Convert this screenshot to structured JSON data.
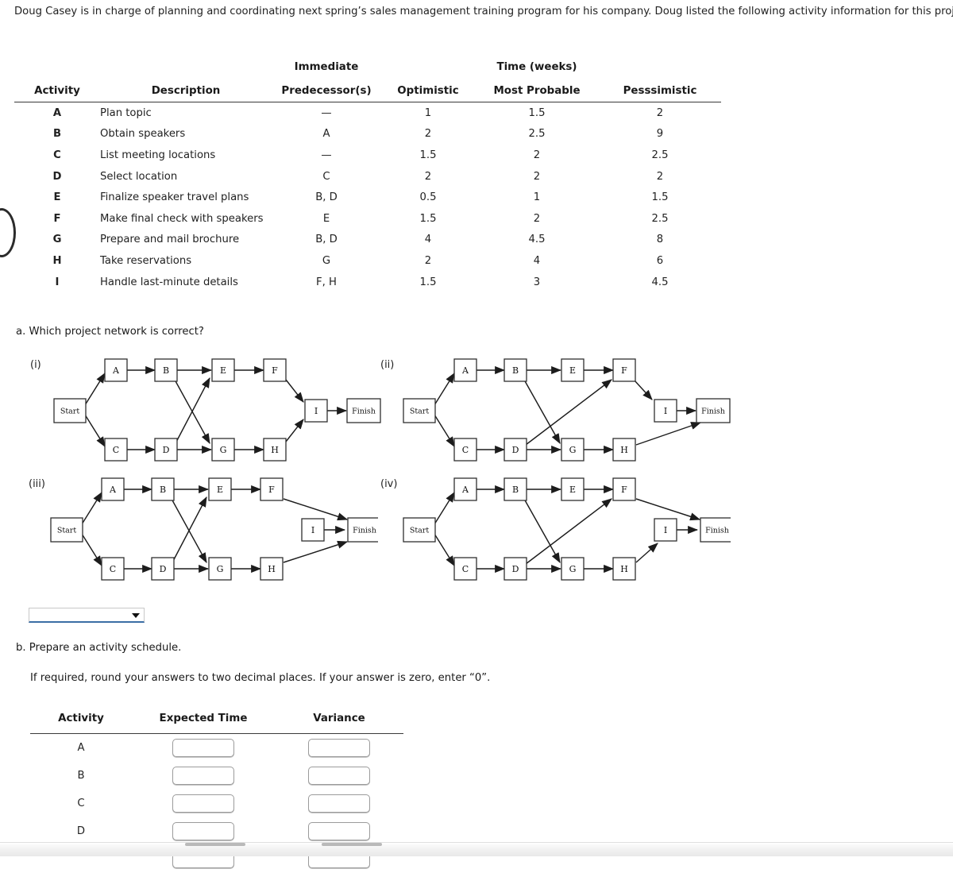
{
  "intro": {
    "text": "Doug Casey is in charge of planning and coordinating next spring’s sales management training program for his company. Doug listed the following activity information for this project:"
  },
  "activity_table": {
    "group_headers": {
      "immediate": "Immediate",
      "time": "Time (weeks)"
    },
    "headers": {
      "activity": "Activity",
      "description": "Description",
      "predecessors": "Predecessor(s)",
      "optimistic": "Optimistic",
      "most_probable": "Most Probable",
      "pessimistic": "Pesssimistic"
    },
    "rows": [
      {
        "activity": "A",
        "description": "Plan topic",
        "predecessors": "—",
        "optimistic": "1",
        "most_probable": "1.5",
        "pessimistic": "2"
      },
      {
        "activity": "B",
        "description": "Obtain speakers",
        "predecessors": "A",
        "optimistic": "2",
        "most_probable": "2.5",
        "pessimistic": "9"
      },
      {
        "activity": "C",
        "description": "List meeting locations",
        "predecessors": "—",
        "optimistic": "1.5",
        "most_probable": "2",
        "pessimistic": "2.5"
      },
      {
        "activity": "D",
        "description": "Select location",
        "predecessors": "C",
        "optimistic": "2",
        "most_probable": "2",
        "pessimistic": "2"
      },
      {
        "activity": "E",
        "description": "Finalize speaker travel plans",
        "predecessors": "B, D",
        "optimistic": "0.5",
        "most_probable": "1",
        "pessimistic": "1.5"
      },
      {
        "activity": "F",
        "description": "Make final check with speakers",
        "predecessors": "E",
        "optimistic": "1.5",
        "most_probable": "2",
        "pessimistic": "2.5"
      },
      {
        "activity": "G",
        "description": "Prepare and mail brochure",
        "predecessors": "B, D",
        "optimistic": "4",
        "most_probable": "4.5",
        "pessimistic": "8"
      },
      {
        "activity": "H",
        "description": "Take reservations",
        "predecessors": "G",
        "optimistic": "2",
        "most_probable": "4",
        "pessimistic": "6"
      },
      {
        "activity": "I",
        "description": "Handle last-minute details",
        "predecessors": "F, H",
        "optimistic": "1.5",
        "most_probable": "3",
        "pessimistic": "4.5"
      }
    ]
  },
  "question_a": {
    "text": "a. Which project network is correct?",
    "diagrams": [
      {
        "label": "(i)",
        "nodes": [
          "Start",
          "A",
          "B",
          "C",
          "D",
          "E",
          "F",
          "G",
          "H",
          "I",
          "Finish"
        ],
        "edges": [
          "Start→A",
          "Start→C",
          "A→B",
          "C→D",
          "B→E",
          "B→G",
          "D→E",
          "D→G",
          "E→F",
          "G→H",
          "F→I",
          "H→I",
          "I→Finish"
        ]
      },
      {
        "label": "(ii)",
        "nodes": [
          "Start",
          "A",
          "B",
          "C",
          "D",
          "E",
          "F",
          "G",
          "H",
          "I",
          "Finish"
        ],
        "edges": [
          "Start→A",
          "Start→C",
          "A→B",
          "C→D",
          "B→E",
          "B→G",
          "D→G",
          "D→F",
          "E→F",
          "G→H",
          "F→I",
          "I→Finish",
          "H→Finish"
        ]
      },
      {
        "label": "(iii)",
        "nodes": [
          "Start",
          "A",
          "B",
          "C",
          "D",
          "E",
          "F",
          "G",
          "H",
          "I",
          "Finish"
        ],
        "edges": [
          "Start→A",
          "Start→C",
          "A→B",
          "C→D",
          "B→E",
          "B→G",
          "D→E",
          "D→G",
          "E→F",
          "G→H",
          "F→Finish",
          "I→Finish",
          "H→Finish"
        ]
      },
      {
        "label": "(iv)",
        "nodes": [
          "Start",
          "A",
          "B",
          "C",
          "D",
          "E",
          "F",
          "G",
          "H",
          "I",
          "Finish"
        ],
        "edges": [
          "Start→A",
          "Start→C",
          "A→B",
          "C→D",
          "B→E",
          "B→G",
          "D→G",
          "D→F",
          "E→F",
          "G→H",
          "H→I",
          "F→Finish",
          "I→Finish"
        ]
      }
    ],
    "answer_select": {
      "value": "",
      "arrow_icon": "chevron-down-icon"
    }
  },
  "question_b": {
    "text": "b. Prepare an activity schedule.",
    "note": "If required, round your answers to two decimal places. If your answer is zero, enter “0”."
  },
  "schedule_table": {
    "headers": {
      "activity": "Activity",
      "expected_time": "Expected Time",
      "variance": "Variance"
    },
    "rows": [
      {
        "activity": "A",
        "expected_time": "",
        "variance": ""
      },
      {
        "activity": "B",
        "expected_time": "",
        "variance": ""
      },
      {
        "activity": "C",
        "expected_time": "",
        "variance": ""
      },
      {
        "activity": "D",
        "expected_time": "",
        "variance": ""
      },
      {
        "activity": "",
        "expected_time": "",
        "variance": ""
      }
    ]
  },
  "colors": {
    "select_underline": "#3b6ea5",
    "rule": "#3a3a3a",
    "text": "#1a1a1a"
  }
}
